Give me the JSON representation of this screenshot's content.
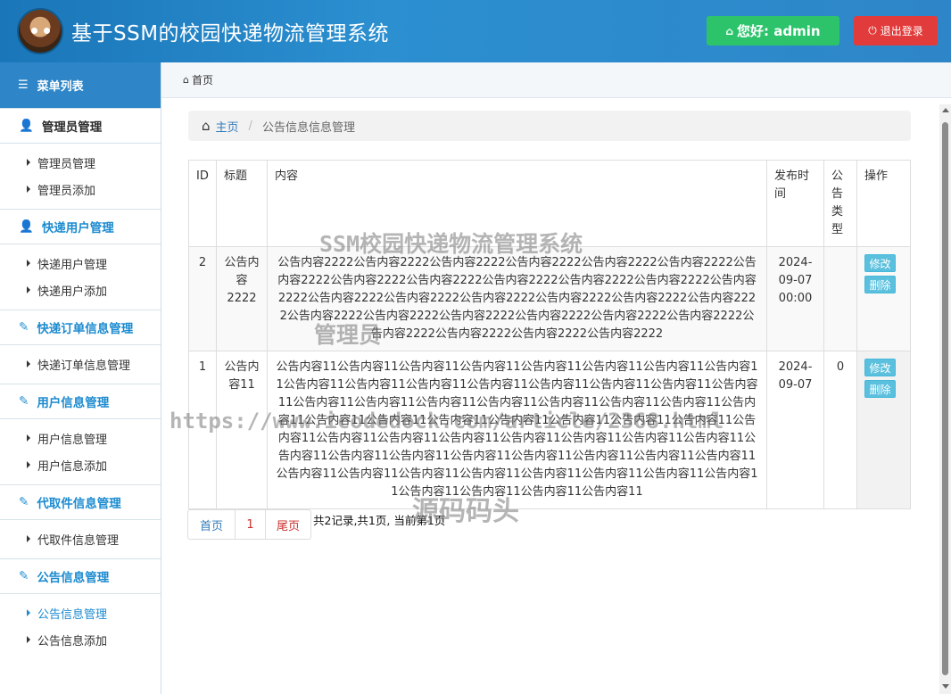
{
  "header": {
    "title": "基于SSM的校园快递物流管理系统",
    "user_label": "您好: admin",
    "logout_label": "退出登录"
  },
  "sidebar": {
    "menu_title": "菜单列表",
    "groups": [
      {
        "title": "管理员管理",
        "items": [
          "管理员管理",
          "管理员添加"
        ]
      },
      {
        "title": "快递用户管理",
        "items": [
          "快递用户管理",
          "快递用户添加"
        ]
      },
      {
        "title": "快递订单信息管理",
        "items": [
          "快递订单信息管理"
        ]
      },
      {
        "title": "用户信息管理",
        "items": [
          "用户信息管理",
          "用户信息添加"
        ]
      },
      {
        "title": "代取件信息管理",
        "items": [
          "代取件信息管理"
        ]
      },
      {
        "title": "公告信息管理",
        "items": [
          "公告信息管理",
          "公告信息添加"
        ]
      }
    ]
  },
  "topbar": {
    "home": "首页"
  },
  "breadcrumb": {
    "home": "主页",
    "current": "公告信息信息管理"
  },
  "table": {
    "headers": [
      "ID",
      "标题",
      "内容",
      "发布时间",
      "公告类型",
      "操作"
    ],
    "rows": [
      {
        "id": "2",
        "title": "公告内容2222",
        "content": "公告内容2222公告内容2222公告内容2222公告内容2222公告内容2222公告内容2222公告内容2222公告内容2222公告内容2222公告内容2222公告内容2222公告内容2222公告内容2222公告内容2222公告内容2222公告内容2222公告内容2222公告内容2222公告内容2222公告内容2222公告内容2222公告内容2222公告内容2222公告内容2222公告内容2222公告内容2222公告内容2222公告内容2222公告内容2222",
        "date": "2024-09-07 00:00",
        "type": "",
        "edit": "修改",
        "delete": "删除"
      },
      {
        "id": "1",
        "title": "公告内容11",
        "content": "公告内容11公告内容11公告内容11公告内容11公告内容11公告内容11公告内容11公告内容11公告内容11公告内容11公告内容11公告内容11公告内容11公告内容11公告内容11公告内容11公告内容11公告内容11公告内容11公告内容11公告内容11公告内容11公告内容11公告内容11公告内容11公告内容11公告内容11公告内容11公告内容11公告内容11公告内容11公告内容11公告内容11公告内容11公告内容11公告内容11公告内容11公告内容11公告内容11公告内容11公告内容11公告内容11公告内容11公告内容11公告内容11公告内容11公告内容11公告内容11公告内容11公告内容11公告内容11公告内容11公告内容11公告内容11公告内容11公告内容11公告内容11公告内容11公告内容11",
        "date": "2024-09-07",
        "type": "0",
        "edit": "修改",
        "delete": "删除"
      }
    ]
  },
  "pager": {
    "first": "首页",
    "current": "1",
    "last": "尾页",
    "info": "共2记录,共1页, 当前第1页"
  },
  "watermarks": {
    "line1": "SSM校园快递物流管理系统",
    "line2": "管理员",
    "line3": "https://www.icodedock.com/article/2368.html",
    "line4": "源码码头"
  },
  "colors": {
    "header": "#2e86c8",
    "user_btn": "#2cc36b",
    "logout_btn": "#e23b3b",
    "accent": "#1c8bd0",
    "action_btn": "#5bc0de"
  }
}
